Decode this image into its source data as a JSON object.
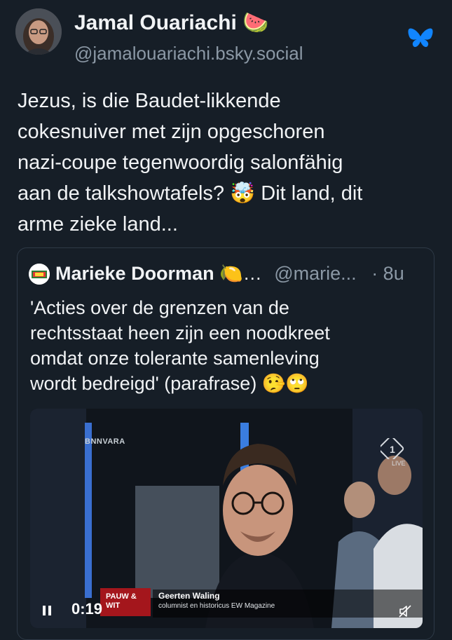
{
  "post": {
    "author_name": "Jamal Ouariachi",
    "author_emoji": "🍉",
    "author_handle": "@jamalouariachi.bsky.social",
    "text": "Jezus, is die Baudet-likkende\ncokesnuiver met zijn opgeschoren\nnazi-coupe tegenwoordig salonfähig\naan de talkshowtafels? 🤯 Dit land, dit\narme zieke land..."
  },
  "quote": {
    "author_name": "Marieke Doorman",
    "author_emoji": "🍋…",
    "author_handle": "@marie...",
    "time": "· 8u",
    "text": "'Acties over de grenzen van de\nrechtsstaat heen zijn een noodkreet\nomdat onze tolerante samenleving\nwordt bedreigd' (parafrase) 🤥🙄"
  },
  "video": {
    "channel": "BNNVARA",
    "live_label": "LIVE",
    "show_logo": "PAUW &\nWIT",
    "guest_name": "Geerten Waling",
    "guest_role": "columnist en historicus EW Magazine",
    "timestamp": "0:19",
    "progress": 0.0
  },
  "icons": {
    "platform": "bluesky-butterfly-icon",
    "pause": "pause-icon",
    "mute": "mute-icon"
  },
  "colors": {
    "background": "#161e27",
    "bluesky": "#1185fe",
    "muted_text": "#8b98a5"
  }
}
